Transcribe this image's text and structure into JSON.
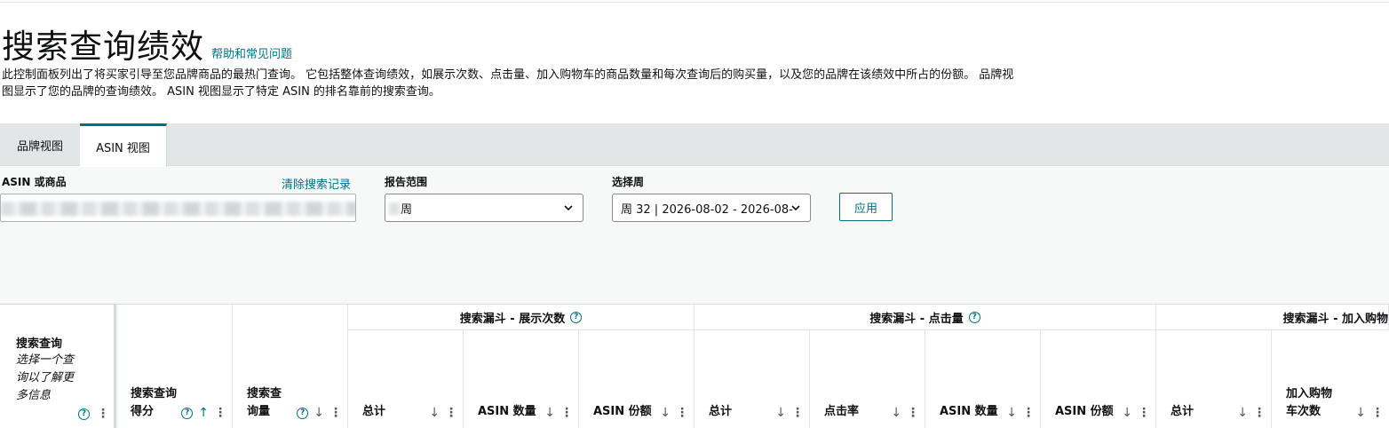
{
  "page": {
    "title": "搜索查询绩效",
    "help_link": "帮助和常见问题",
    "description": "此控制面板列出了将买家引导至您品牌商品的最热门查询。 它包括整体查询绩效，如展示次数、点击量、加入购物车的商品数量和每次查询后的购买量，以及您的品牌在该绩效中所占的份额。 品牌视图显示了您的品牌的查询绩效。 ASIN 视图显示了特定 ASIN 的排名靠前的搜索查询。"
  },
  "tabs": [
    {
      "label": "品牌视图",
      "active": false
    },
    {
      "label": "ASIN 视图",
      "active": true
    }
  ],
  "filters": {
    "asin_label": "ASIN 或商品",
    "clear_label": "清除搜索记录",
    "range_label": "报告范围",
    "range_value": "周",
    "week_label": "选择周",
    "week_value": "周 32 | 2026-08-02 - 2026-08-",
    "apply_label": "应用"
  },
  "table": {
    "query_col": {
      "title": "搜索查询",
      "subtitle": "选择一个查询以了解更多信息"
    },
    "score_col": "搜索查询得分",
    "volume_col": "搜索查询量",
    "groups": [
      {
        "label": "搜索漏斗 - 展示次数"
      },
      {
        "label": "搜索漏斗 - 点击量"
      },
      {
        "label": "搜索漏斗 - 加入购物"
      }
    ],
    "sub_headers": [
      "总计",
      "ASIN 数量",
      "ASIN 份额",
      "总计",
      "点击率",
      "ASIN 数量",
      "ASIN 份额",
      "总计",
      "加入购物车次数"
    ]
  },
  "icons": {
    "help": "question-circle-icon",
    "sort": "arrow-down-icon",
    "menu": "kebab-icon",
    "dropdown": "chevron-down-icon"
  },
  "colors": {
    "accent": "#007185",
    "tab_bar": "#e3e6e6",
    "panel": "#f7f8f8"
  }
}
